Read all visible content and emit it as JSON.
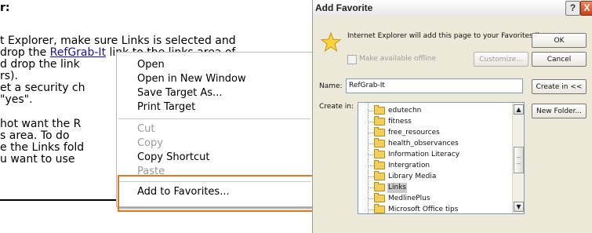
{
  "document": {
    "lines": [
      "r:",
      "t Explorer, make sure Links is selected and",
      "drop the ",
      "link to the links area of",
      "d drop the link",
      "rs).",
      "et a security ch",
      "\"yes\".",
      "hot want the R",
      "s area. To do",
      "e the Links fold",
      "u want to use"
    ],
    "link_text": "RefGrab-It"
  },
  "context_menu": {
    "items": [
      "Open",
      "Open in New Window",
      "Save Target As...",
      "Print Target",
      "Cut",
      "Copy",
      "Copy Shortcut",
      "Paste",
      "Add to Favorites..."
    ]
  },
  "dialog": {
    "title": "Add Favorite",
    "help_glyph": "?",
    "close_glyph": "X",
    "description": "Internet Explorer will add this page to your Favorites list.",
    "offline_label": "Make available offline",
    "ok": "OK",
    "cancel": "Cancel",
    "customize": "Customize...",
    "name_label": "Name:",
    "name_value": "RefGrab-It",
    "create_in_button": "Create in <<",
    "create_in_label": "Create in:",
    "new_folder": "New Folder...",
    "folders": [
      "edutechn",
      "fitness",
      "free_resources",
      "health_observances",
      "Information Literacy",
      "Intergration",
      "Library Media",
      "Links",
      "MedlinePlus",
      "Microsoft Office tips"
    ],
    "selected_folder": "Links",
    "icons": [
      "star-icon",
      "folder-icon",
      "scroll-up-arrow",
      "scroll-down-arrow"
    ],
    "colors": {
      "highlight_box": "#e8761c",
      "link": "#1a0dab",
      "dialog_bg": "#ece9d8",
      "close_button": "#d9582f"
    }
  }
}
